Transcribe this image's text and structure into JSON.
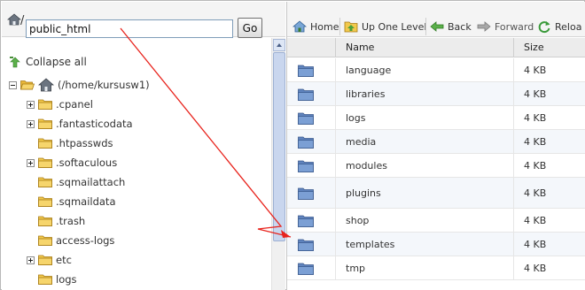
{
  "address_bar": {
    "slash": "/",
    "path_value": "public_html",
    "go_label": "Go"
  },
  "tree": {
    "collapse_all_label": "Collapse all",
    "root_label": "(/home/kursusw1)",
    "items": [
      {
        "label": ".cpanel",
        "expandable": true
      },
      {
        "label": ".fantasticodata",
        "expandable": true
      },
      {
        "label": ".htpasswds",
        "expandable": false
      },
      {
        "label": ".softaculous",
        "expandable": true
      },
      {
        "label": ".sqmailattach",
        "expandable": false
      },
      {
        "label": ".sqmaildata",
        "expandable": false
      },
      {
        "label": ".trash",
        "expandable": false
      },
      {
        "label": "access-logs",
        "expandable": false
      },
      {
        "label": "etc",
        "expandable": true
      },
      {
        "label": "logs",
        "expandable": false
      }
    ]
  },
  "toolbar": {
    "home_label": "Home",
    "up_one_level_label": "Up One Level",
    "back_label": "Back",
    "forward_label": "Forward",
    "reload_label": "Reloa"
  },
  "file_list": {
    "columns": {
      "name": "Name",
      "size": "Size"
    },
    "rows": [
      {
        "name": "language",
        "size": "4 KB"
      },
      {
        "name": "libraries",
        "size": "4 KB"
      },
      {
        "name": "logs",
        "size": "4 KB"
      },
      {
        "name": "media",
        "size": "4 KB"
      },
      {
        "name": "modules",
        "size": "4 KB"
      },
      {
        "name": "plugins",
        "size": "4 KB"
      },
      {
        "name": "shop",
        "size": "4 KB"
      },
      {
        "name": "templates",
        "size": "4 KB"
      },
      {
        "name": "tmp",
        "size": "4 KB"
      }
    ]
  },
  "colors": {
    "folder_yellow": "#f2c94c",
    "folder_blue": "#6d8fc7",
    "annotation_arrow": "#e8231c",
    "alt_row": "#f4f7fb"
  },
  "icons": {
    "home": "house-icon",
    "up": "up-folder-icon",
    "back": "green-left-arrow-icon",
    "forward": "gray-right-arrow-icon",
    "reload": "reload-icon",
    "collapse": "collapse-arrow-icon",
    "folder": "folder-icon"
  }
}
